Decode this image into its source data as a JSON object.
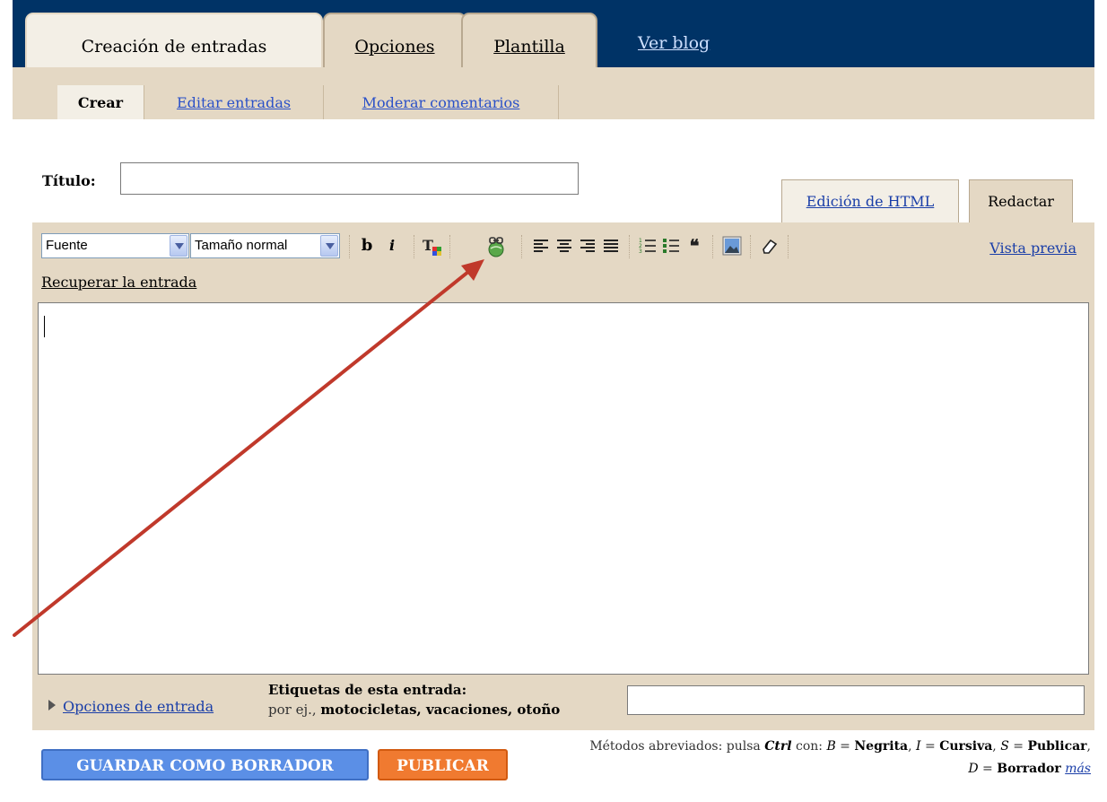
{
  "nav": {
    "tabs": [
      {
        "label": "Creación de entradas",
        "active": true
      },
      {
        "label": "Opciones",
        "active": false
      },
      {
        "label": "Plantilla",
        "active": false
      }
    ],
    "view_blog": "Ver blog"
  },
  "subnav": {
    "items": [
      {
        "label": "Crear",
        "active": true
      },
      {
        "label": "Editar entradas",
        "active": false
      },
      {
        "label": "Moderar comentarios",
        "active": false
      }
    ]
  },
  "post": {
    "title_label": "Título:",
    "title_value": ""
  },
  "mode_tabs": {
    "html": "Edición de HTML",
    "compose": "Redactar"
  },
  "toolbar": {
    "font_select": "Fuente",
    "size_select": "Tamaño normal",
    "bold": "b",
    "italic": "i",
    "preview": "Vista previa"
  },
  "recover_post": "Recuperar la entrada",
  "post_options": "Opciones de entrada",
  "labels": {
    "title": "Etiquetas de esta entrada:",
    "hint_prefix": "por ej., ",
    "hint_examples": "motocicletas, vacaciones, otoño"
  },
  "buttons": {
    "save_draft": "GUARDAR COMO BORRADOR",
    "publish": "PUBLICAR"
  },
  "shortcuts": {
    "intro": "Métodos abreviados: pulsa ",
    "ctrl": "Ctrl",
    "con": " con: ",
    "b_key": "B",
    "b_action": "Negrita",
    "i_key": "I",
    "i_action": "Cursiva",
    "s_key": "S",
    "s_action": "Publicar",
    "d_key": "D",
    "d_action": "Borrador",
    "more": "más"
  },
  "colors": {
    "navy": "#003366",
    "tan": "#e4d8c4",
    "draft_button": "#5b8fe6",
    "publish_button": "#f07a30",
    "annotation_arrow": "#c0392b"
  }
}
